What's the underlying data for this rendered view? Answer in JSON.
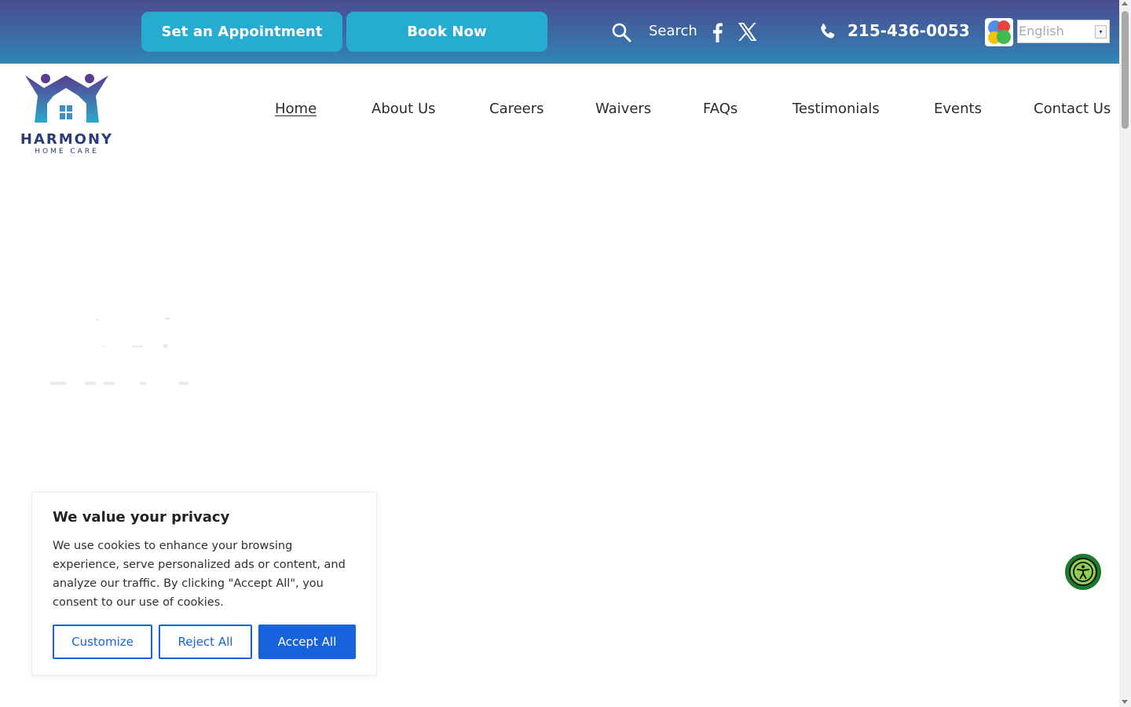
{
  "topbar": {
    "appointment_label": "Set an Appointment",
    "book_label": "Book Now",
    "search_label": "Search",
    "phone": "215-436-0053",
    "language": {
      "selected": "English"
    }
  },
  "logo": {
    "name": "HARMONY",
    "tagline": "HOME CARE"
  },
  "nav": {
    "items": [
      {
        "label": "Home",
        "active": true
      },
      {
        "label": "About Us"
      },
      {
        "label": "Careers"
      },
      {
        "label": "Waivers"
      },
      {
        "label": "FAQs"
      },
      {
        "label": "Testimonials"
      },
      {
        "label": "Events"
      },
      {
        "label": "Contact Us"
      }
    ]
  },
  "cookie_banner": {
    "title": "We value your privacy",
    "body": "We use cookies to enhance your browsing experience, serve personalized ads or content, and analyze our traffic. By clicking \"Accept All\", you consent to our use of cookies.",
    "customize_label": "Customize",
    "reject_label": "Reject All",
    "accept_label": "Accept All"
  },
  "colors": {
    "topbar_gradient": [
      "#4a4c8f",
      "#2f86b6"
    ],
    "button_teal": "#27acd1",
    "cookie_blue": "#1863dc",
    "logo_purple": "#5a3d91",
    "logo_teal": "#2aa9c9",
    "a11y_green": "#8fd14f"
  },
  "icons": {
    "search": "search-icon",
    "facebook": "facebook-icon",
    "x": "x-twitter-icon",
    "phone": "phone-icon",
    "google_translate": "google-translate-icon",
    "accessibility": "accessibility-icon"
  }
}
